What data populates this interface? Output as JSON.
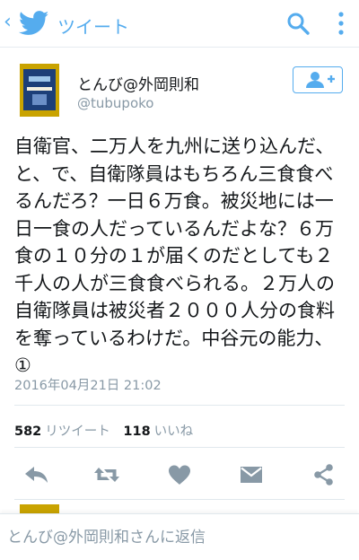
{
  "header": {
    "back_icon": "chevron-left-icon",
    "logo_icon": "twitter-bird-icon",
    "title": "ツイート",
    "search_icon": "search-icon",
    "more_icon": "more-vertical-icon",
    "accent_color": "#55acee"
  },
  "tweet": {
    "author_name": "とんび@外岡則和",
    "author_handle": "@tubupoko",
    "follow_icon": "add-user-icon",
    "text": "自衛官、二万人を九州に送り込んだ、と、で、自衛隊員はもちろん三食食べるんだろ？一日６万食。被災地には一日一食の人だっているんだよな？６万食の１０分の１が届くのだとしても２千人の人が三食食べられる。２万人の自衛隊員は被災者２０００人分の食料を奪っているわけだ。中谷元の能力、①",
    "timestamp": "2016年04月21日 21:02",
    "retweet_count": "582",
    "retweet_label": "リツイート",
    "like_count": "118",
    "like_label": "いいね"
  },
  "actions": [
    {
      "icon": "reply-icon"
    },
    {
      "icon": "retweet-icon"
    },
    {
      "icon": "heart-icon"
    },
    {
      "icon": "direct-message-icon"
    },
    {
      "icon": "share-icon"
    }
  ],
  "reply_bar": {
    "placeholder": "とんび@外岡則和さんに返信"
  }
}
